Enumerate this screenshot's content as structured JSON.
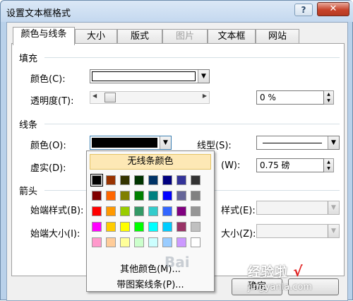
{
  "window": {
    "title": "设置文本框格式",
    "help": "?",
    "close": "✕"
  },
  "tabs": [
    {
      "label": "颜色与线条",
      "active": true,
      "disabled": false
    },
    {
      "label": "大小",
      "active": false,
      "disabled": false
    },
    {
      "label": "版式",
      "active": false,
      "disabled": false
    },
    {
      "label": "图片",
      "active": false,
      "disabled": true
    },
    {
      "label": "文本框",
      "active": false,
      "disabled": false
    },
    {
      "label": "网站",
      "active": false,
      "disabled": false
    }
  ],
  "fill": {
    "section": "填充",
    "color_label": "颜色(C):",
    "color_value": "#ffffff",
    "transparency_label": "透明度(T):",
    "transparency_value": "0 %"
  },
  "line": {
    "section": "线条",
    "color_label": "颜色(O):",
    "color_value": "#000000",
    "style_label": "线型(S):",
    "dash_label": "虚实(D):",
    "weight_label": "(W):",
    "weight_value": "0.75 磅"
  },
  "arrows": {
    "section": "箭头",
    "begin_style_label": "始端样式(B):",
    "begin_size_label": "始端大小(I):",
    "end_style_label": "样式(E):",
    "end_size_label": "大小(Z):"
  },
  "color_popup": {
    "no_line": "无线条颜色",
    "more_colors": "其他颜色(M)...",
    "patterned_lines": "带图案线条(P)...",
    "palette": [
      [
        "#000000",
        "#993300",
        "#333300",
        "#003300",
        "#003366",
        "#000080",
        "#333399",
        "#333333"
      ],
      [
        "#800000",
        "#ff6600",
        "#808000",
        "#008000",
        "#008080",
        "#0000ff",
        "#666699",
        "#808080"
      ],
      [
        "#ff0000",
        "#ff9900",
        "#99cc00",
        "#339966",
        "#33cccc",
        "#3366ff",
        "#800080",
        "#969696"
      ],
      [
        "#ff00ff",
        "#ffcc00",
        "#ffff00",
        "#00ff00",
        "#00ffff",
        "#00ccff",
        "#993366",
        "#c0c0c0"
      ],
      [
        "#ff99cc",
        "#ffcc99",
        "#ffff99",
        "#ccffcc",
        "#ccffff",
        "#99ccff",
        "#cc99ff",
        "#ffffff"
      ]
    ]
  },
  "buttons": {
    "ok": "确定"
  },
  "watermark": {
    "line1": "经验啦",
    "line2": "jingyanla.com",
    "check": "√",
    "baidu": "Bai"
  }
}
